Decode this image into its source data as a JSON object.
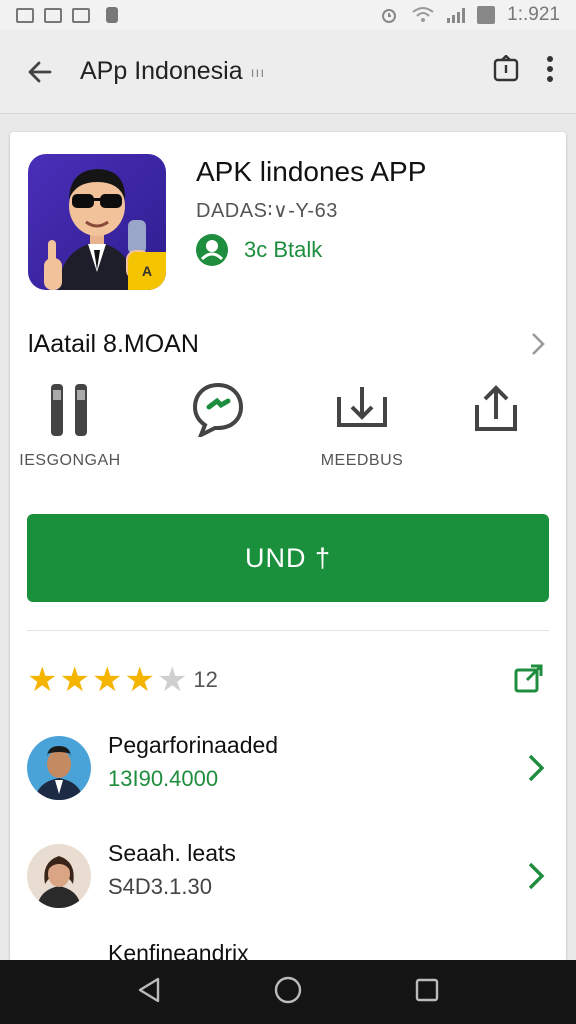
{
  "status_bar": {
    "time": "1:.921"
  },
  "toolbar": {
    "title": "APp Indonesia",
    "subtitle": "ııı"
  },
  "app": {
    "name": "APK lindones APP",
    "developer": "DADAS∶∨-Y-63",
    "contact": "3c Btalk",
    "icon_badge": "A",
    "detail": "lAatail 8.MOAN"
  },
  "actions": [
    {
      "label": "IESGONGAH"
    },
    {
      "label": ""
    },
    {
      "label": "MEEDBUS"
    },
    {
      "label": ""
    }
  ],
  "install": {
    "label": "UND †"
  },
  "rating": {
    "count": "12",
    "stars": 4,
    "star_color": "#f5b400",
    "empty_star_color": "#cfcfcf"
  },
  "users": [
    {
      "name": "Pegarforinaaded",
      "value": "13I90.4000",
      "value_color": "#1e8e3e"
    },
    {
      "name": "Seaah. leats",
      "value": "S4D3.1.30",
      "value_color": "#444444"
    }
  ],
  "partial_row": {
    "text": "Kenfineandrix"
  },
  "colors": {
    "accent": "#1a8f3c",
    "green_text": "#1e8e3e"
  }
}
